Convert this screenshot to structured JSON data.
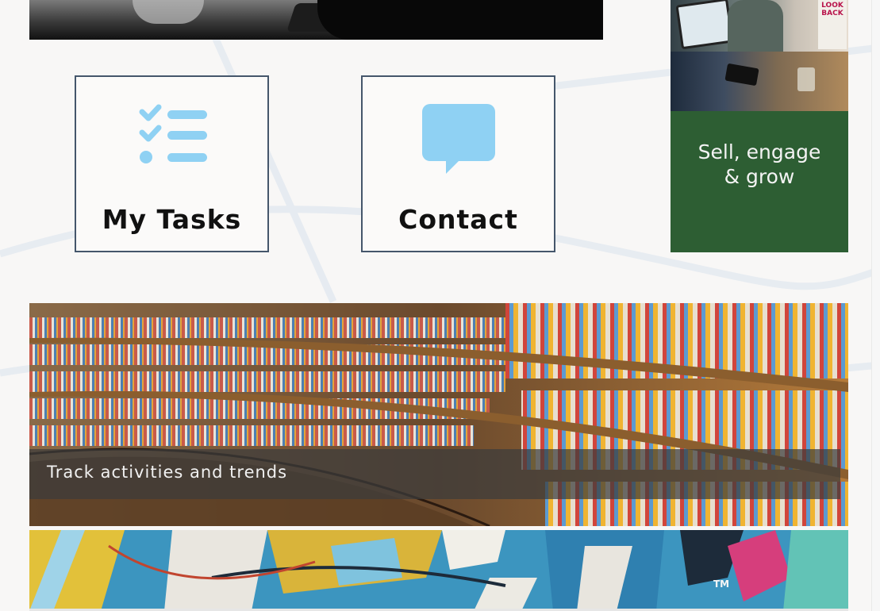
{
  "tiles": [
    {
      "label": "My Tasks",
      "icon": "checklist-icon"
    },
    {
      "label": "Contact",
      "icon": "chat-bubble-icon"
    }
  ],
  "promo": {
    "title_line1": "Sell, engage",
    "title_line2": "& grow",
    "sign_text": "LOOK BACK",
    "color": "#2d5e33"
  },
  "library_banner": {
    "caption": "Track activities and trends"
  },
  "art_banner": {
    "trademark": "TM"
  },
  "colors": {
    "icon_blue": "#8fd1f3",
    "tile_border": "#45566b",
    "promo_green": "#2d5e33"
  }
}
